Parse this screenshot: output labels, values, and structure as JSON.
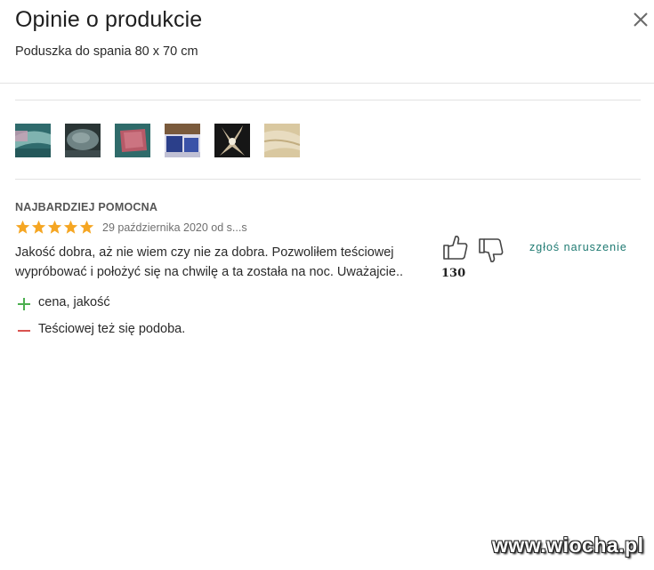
{
  "dialog": {
    "title": "Opinie o produkcie",
    "subtitle": "Poduszka do spania 80 x 70 cm",
    "close_icon": "close-icon"
  },
  "gallery": {
    "thumbnails": [
      {
        "name": "photo-thumbnail-1",
        "colors": [
          "#2f6b6d",
          "#7fb3b0",
          "#c9a0b5"
        ]
      },
      {
        "name": "photo-thumbnail-2",
        "colors": [
          "#3d4a4c",
          "#6f8384",
          "#2a3535"
        ]
      },
      {
        "name": "photo-thumbnail-3",
        "colors": [
          "#b85a68",
          "#2f6b6a",
          "#d98592"
        ]
      },
      {
        "name": "photo-thumbnail-4",
        "colors": [
          "#2b3f8a",
          "#d9d9e8",
          "#7a5a3c"
        ]
      },
      {
        "name": "photo-thumbnail-5",
        "colors": [
          "#161616",
          "#c8b89a",
          "#f2ecdc"
        ]
      },
      {
        "name": "photo-thumbnail-6",
        "colors": [
          "#d9c8a0",
          "#e8dcc0",
          "#c2ad80"
        ]
      }
    ]
  },
  "review": {
    "badge": "NAJBARDZIEJ POMOCNA",
    "rating": 5,
    "rating_max": 5,
    "star_color": "#f5a623",
    "meta": "29 października 2020 od s...s",
    "text": "Jakość dobra, aż nie wiem czy nie za dobra. Pozwoliłem teściowej wypróbować i położyć się na chwilę a ta została na noc. Uważajcie..",
    "pros": "cena, jakość",
    "cons": "Teściowej też się podoba.",
    "pro_color": "#4caf50",
    "con_color": "#d9534f",
    "helpful_count": "130",
    "report_label": "zgłoś naruszenie",
    "thumbs_up_icon": "thumbs-up-icon",
    "thumbs_down_icon": "thumbs-down-icon"
  },
  "watermark": "www.wiocha.pl"
}
